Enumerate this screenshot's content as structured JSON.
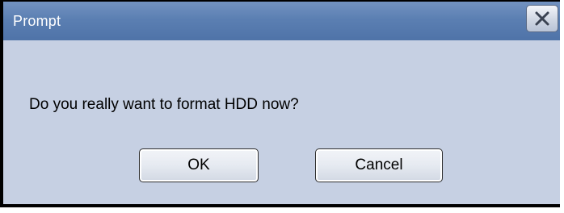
{
  "dialog": {
    "title": "Prompt",
    "message": "Do you really want to format HDD now?",
    "ok_label": "OK",
    "cancel_label": "Cancel",
    "close_icon": "close-icon"
  },
  "colors": {
    "titlebar": "#5b7fb2",
    "body": "#c6d0e3",
    "title_text": "#ffffff"
  }
}
